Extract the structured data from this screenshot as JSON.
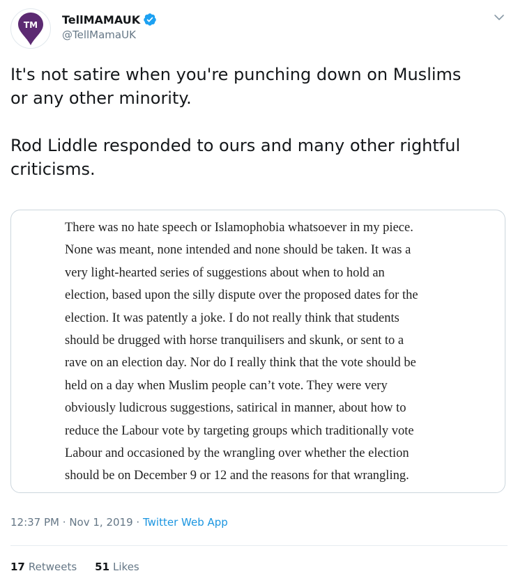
{
  "user": {
    "display_name": "TellMAMAUK",
    "handle": "@TellMamaUK",
    "avatar_text": "TM",
    "avatar_color": "#5c2a72",
    "verified": true,
    "verified_color": "#1da1f2"
  },
  "tweet": {
    "paragraphs": [
      "It's not satire when you're punching down on Muslims or any other minority.",
      "Rod Liddle responded to ours and many other rightful criticisms."
    ],
    "paragraph_lines": [
      [
        "It's not satire when you're punching down on Muslims",
        "or any other minority."
      ],
      [
        "Rod Liddle responded to ours and many other rightful",
        "criticisms."
      ]
    ]
  },
  "media": {
    "lines": [
      "There was no hate speech or Islamophobia whatsoever in my piece.",
      "None was meant, none intended and none should be taken. It was a",
      "very light-hearted series of suggestions about when to hold an",
      "election, based upon the silly dispute over the proposed dates for the",
      "election. It was patently a joke. I do not really think that students",
      "should be drugged with horse tranquilisers and skunk, or sent to a",
      "rave on an election day. Nor do I really think that the vote should be",
      "held on a day when Muslim people can’t vote. They were very",
      "obviously ludicrous suggestions, satirical in manner, about how to",
      "reduce the Labour vote by targeting groups which traditionally vote",
      "Labour and occasioned by the wrangling over whether the election",
      "should be on December 9 or 12 and the reasons for that wrangling."
    ]
  },
  "meta": {
    "time": "12:37 PM",
    "separator": "·",
    "date": "Nov 1, 2019",
    "source": "Twitter Web App",
    "link_color": "#1b95e0"
  },
  "stats": {
    "retweets_count": "17",
    "retweets_label": "Retweets",
    "likes_count": "51",
    "likes_label": "Likes"
  },
  "icons": {
    "caret": "chevron-down-icon",
    "verified": "verified-badge-icon"
  }
}
